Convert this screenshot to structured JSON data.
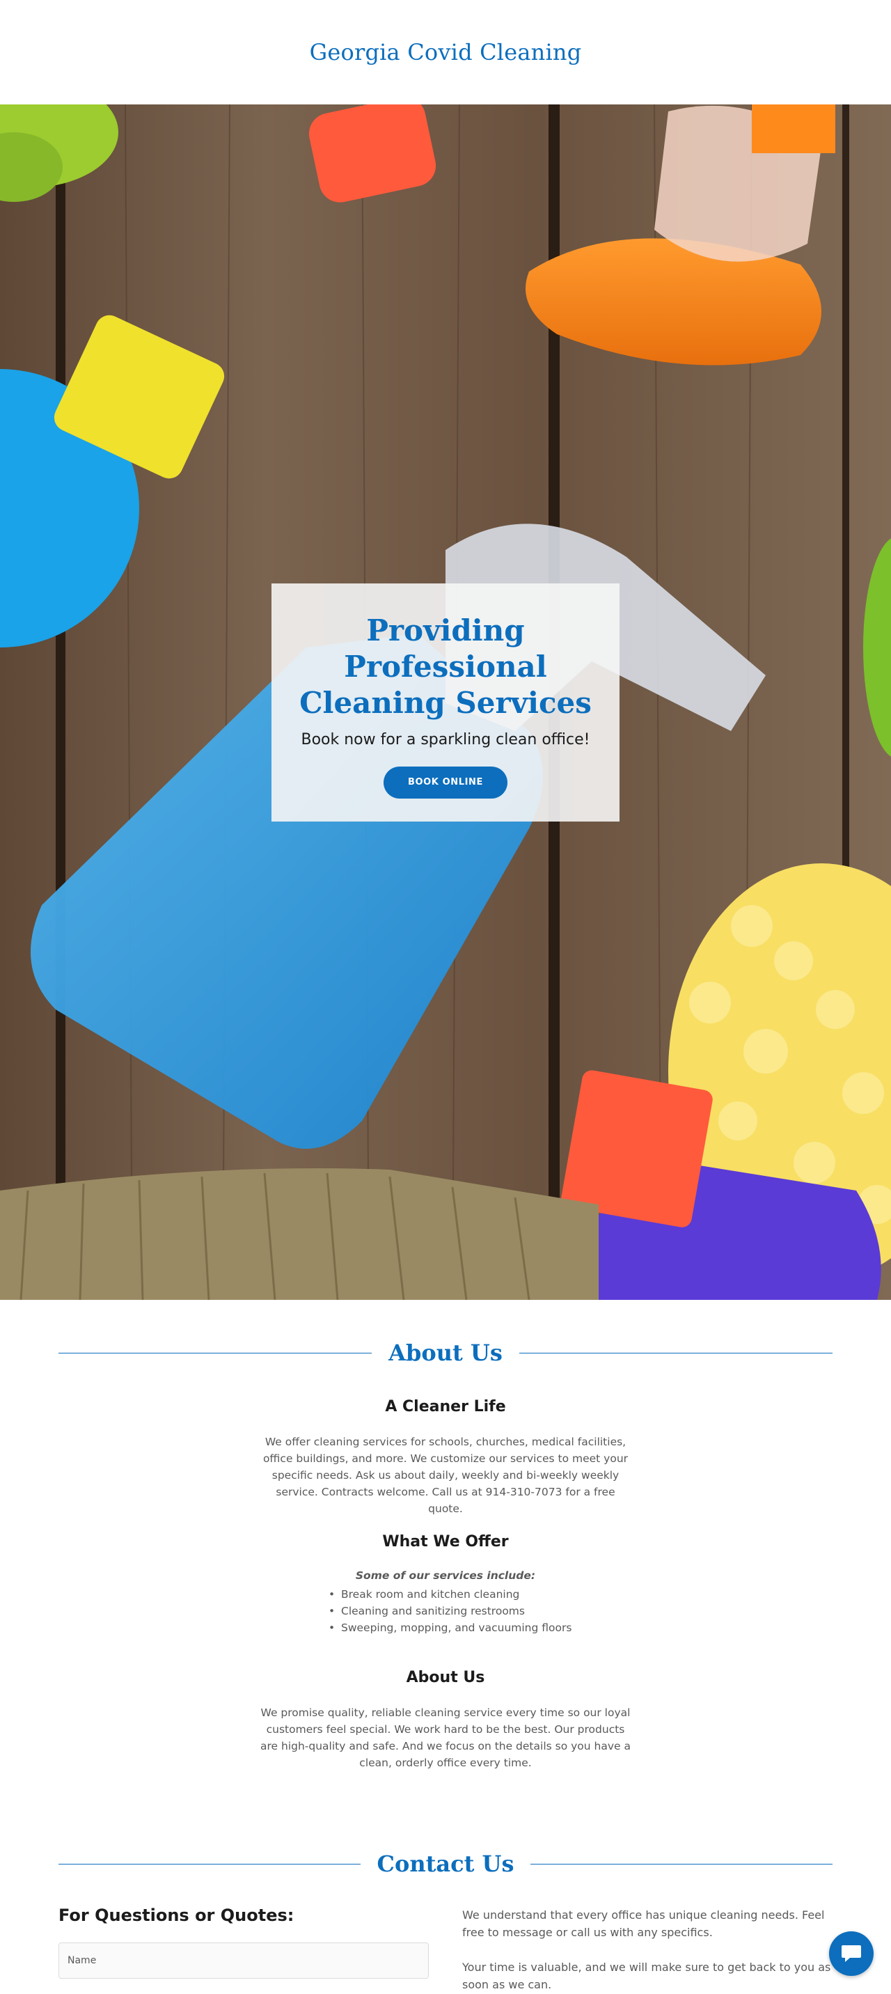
{
  "header": {
    "site_title": "Georgia Covid Cleaning"
  },
  "hero": {
    "headline": "Providing Professional Cleaning Services",
    "subheadline": "Book now for a sparkling clean office!",
    "cta_label": "BOOK ONLINE"
  },
  "about": {
    "section_title": "About Us",
    "blocks": [
      {
        "title": "A Cleaner Life",
        "text": "We offer cleaning services for schools, churches, medical facilities, office buildings, and more. We customize our services to meet your specific needs. Ask us about daily, weekly and bi-weekly weekly service. Contracts welcome. Call us at 914-310-7073 for a free quote."
      },
      {
        "title": "What We Offer",
        "intro": "Some of our services include:",
        "items": [
          "Break room and kitchen cleaning",
          "Cleaning and sanitizing restrooms",
          "Sweeping, mopping, and vacuuming floors"
        ]
      },
      {
        "title": "About Us",
        "text": "We promise quality, reliable cleaning service every time so our loyal customers feel special. We work hard to be the best. Our products are high-quality and safe. And we focus on the details so you have a clean, orderly office every time."
      }
    ]
  },
  "contact": {
    "section_title": "Contact Us",
    "form_title": "For Questions or Quotes:",
    "name_placeholder": "Name",
    "paragraphs": [
      "We understand that every office has unique cleaning needs. Feel free to message or call us with any specifics.",
      "Your time is valuable, and we will make sure to get back to you as soon as we can."
    ]
  },
  "chat": {
    "icon": "chat-bubble-icon"
  },
  "colors": {
    "brand": "#0c6ebd",
    "text": "#1b1b1b",
    "muted": "#595959"
  }
}
